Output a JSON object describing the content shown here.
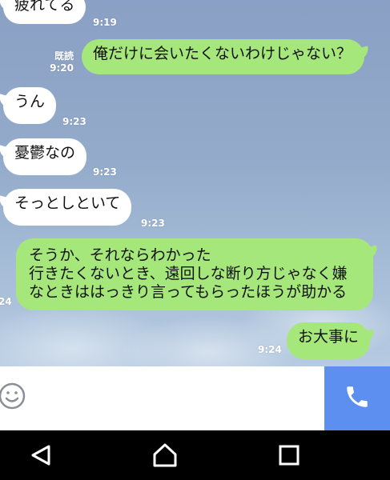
{
  "messages": [
    {
      "side": "in",
      "text": "疲れてる",
      "time": "9:19"
    },
    {
      "side": "out",
      "text": "俺だけに会いたくないわけじゃない？",
      "read": "既読",
      "time": "9:20"
    },
    {
      "side": "in",
      "text": "うん",
      "time": "9:23"
    },
    {
      "side": "in",
      "text": "憂鬱なの",
      "time": "9:23"
    },
    {
      "side": "in",
      "text": "そっとしといて",
      "time": "9:23"
    },
    {
      "side": "out",
      "text": "そうか、それならわかった\n行きたくないとき、遠回しな断り方じゃなく嫌\nなときははっきり言ってもらったほうが助かる",
      "time_partial": "24"
    },
    {
      "side": "out",
      "text": "お大事に",
      "time": "9:24"
    }
  ],
  "input_bar": {
    "emoji_icon": "smiley-icon",
    "call_icon": "phone-icon",
    "call_button_color": "#5d8ff0"
  },
  "nav_bar": {
    "back_icon": "back-triangle-icon",
    "home_icon": "home-icon",
    "recents_icon": "recents-square-icon"
  },
  "colors": {
    "outgoing_bubble": "#a6e77b",
    "incoming_bubble": "#ffffff"
  }
}
